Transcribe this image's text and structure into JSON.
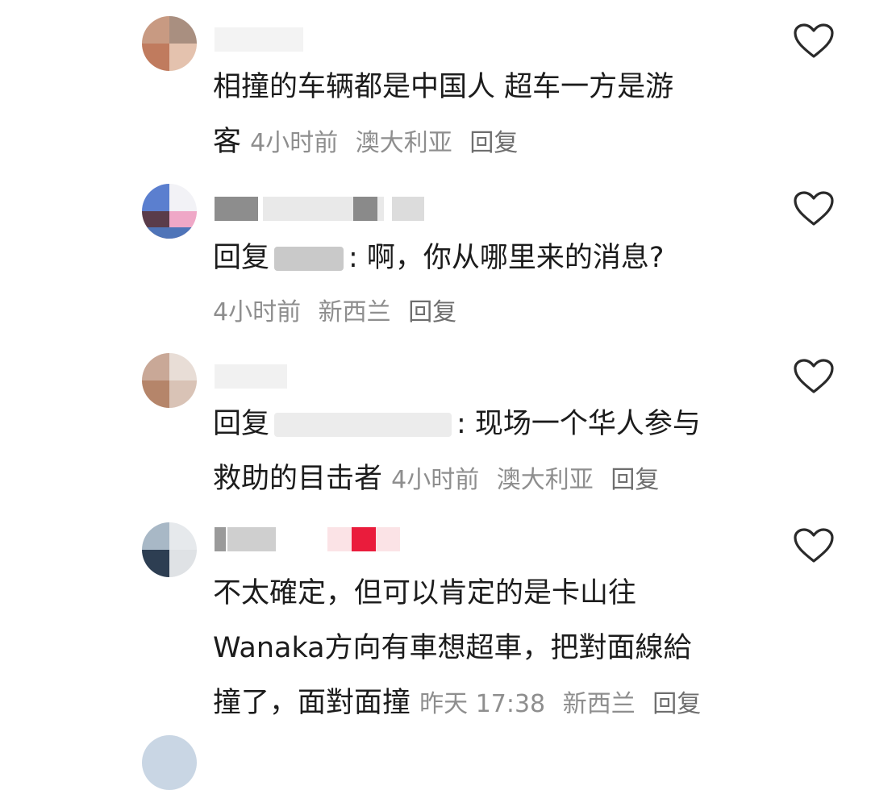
{
  "comments": [
    {
      "text_lines": [
        "相撞的车辆都是中国人 超车一方是游",
        "客"
      ],
      "time": "4小时前",
      "location": "澳大利亚",
      "reply_label": "回复"
    },
    {
      "reply_prefix": "回复",
      "text": ": 啊，你从哪里来的消息?",
      "time": "4小时前",
      "location": "新西兰",
      "reply_label": "回复"
    },
    {
      "reply_prefix": "回复",
      "text_line1": ": 现场一个华人参与",
      "text_line2": "救助的目击者",
      "time": "4小时前",
      "location": "澳大利亚",
      "reply_label": "回复"
    },
    {
      "text_lines": [
        "不太確定，但可以肯定的是卡山往",
        "Wanaka方向有車想超車，把對面線給",
        "撞了，面對面撞"
      ],
      "time": "昨天 17:38",
      "location": "新西兰",
      "reply_label": "回复"
    }
  ],
  "icons": {
    "like": "heart-outline-icon"
  },
  "colors": {
    "text": "#1c1c1c",
    "meta": "#8e8e8e",
    "icon": "#2a2a2a"
  }
}
